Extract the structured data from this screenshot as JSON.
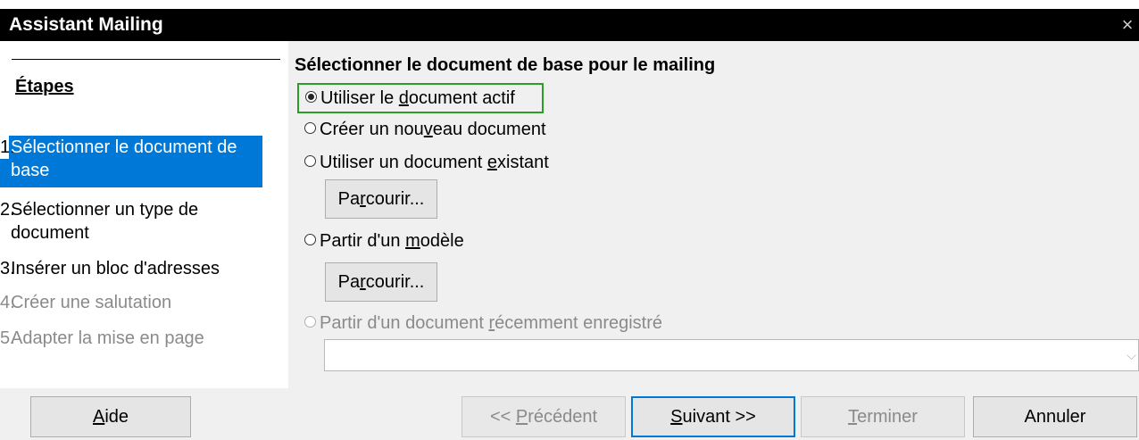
{
  "window": {
    "title": "Assistant Mailing",
    "close_glyph": "×"
  },
  "sidebar": {
    "heading": "Étapes",
    "steps": [
      {
        "num": "1.",
        "label": "Sélectionner le document de base",
        "state": "selected"
      },
      {
        "num": "2.",
        "label": "Sélectionner un type de document",
        "state": "enabled"
      },
      {
        "num": "3.",
        "label": "Insérer un bloc d'adresses",
        "state": "enabled"
      },
      {
        "num": "4.",
        "label": "Créer une salutation",
        "state": "disabled"
      },
      {
        "num": "5.",
        "label": "Adapter la mise en page",
        "state": "disabled"
      }
    ]
  },
  "main": {
    "heading": "Sélectionner le document de base pour le mailing",
    "options": {
      "active": {
        "pre": "Utiliser le ",
        "accel": "d",
        "post": "ocument actif",
        "checked": true
      },
      "new": {
        "pre": "Créer un nou",
        "accel": "v",
        "post": "eau document",
        "checked": false
      },
      "existing": {
        "pre": "Utiliser un document ",
        "accel": "e",
        "post": "xistant",
        "checked": false
      },
      "template": {
        "pre": "Partir d'un ",
        "accel": "m",
        "post": "odèle",
        "checked": false
      },
      "recent": {
        "pre": "Partir d'un document ",
        "accel": "r",
        "post": "écemment enregistré",
        "checked": false,
        "disabled": true
      }
    },
    "browse": {
      "pre": "Pa",
      "accel": "r",
      "post": "courir..."
    },
    "recent_select": {
      "value": ""
    }
  },
  "footer": {
    "help": {
      "pre": "",
      "accel": "A",
      "post": "ide"
    },
    "prev": {
      "pre": "<< ",
      "accel": "P",
      "post": "récédent"
    },
    "next": {
      "pre": "",
      "accel": "S",
      "post": "uivant >>"
    },
    "finish": {
      "pre": "",
      "accel": "T",
      "post": "erminer"
    },
    "cancel": {
      "label": "Annuler"
    }
  },
  "colors": {
    "selection": "#0078d7",
    "focus_outline": "#2a9d2a",
    "title_bar": "#000000",
    "dialog_bg": "#f0f0f0"
  }
}
